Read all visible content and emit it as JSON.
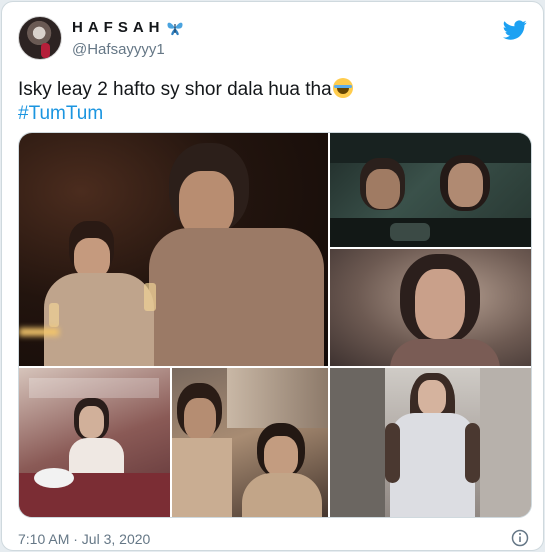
{
  "tweet": {
    "author": {
      "display_name": "HAFSAH",
      "handle": "@Hafsayyyy1"
    },
    "text": "Isky leay 2 hafto sy shor dala hua tha",
    "hashtag": "#TumTum",
    "timestamp": "7:10 AM · Jul 3, 2020",
    "media_count": 6
  },
  "icons": {
    "bird": "twitter-bird-icon",
    "butterfly": "butterfly-emoji-icon",
    "emoji": "tears-of-joy-emoji-icon",
    "info": "info-icon"
  },
  "colors": {
    "link": "#1b95e0",
    "brand": "#1da1f2",
    "secondary_text": "#657786",
    "border": "#cfd9de"
  }
}
